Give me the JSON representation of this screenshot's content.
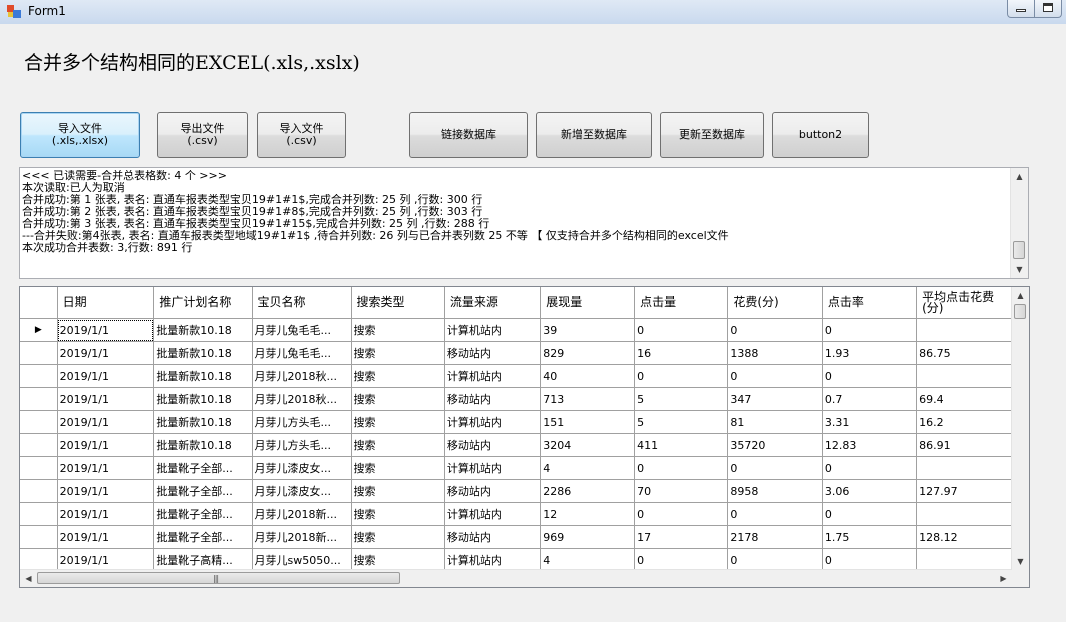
{
  "window": {
    "title": "Form1"
  },
  "heading": "合并多个结构相同的EXCEL(.xls,.xslx)",
  "buttons": {
    "import_xls": {
      "line1": "导入文件",
      "line2": "(.xls,.xlsx)"
    },
    "export_csv": {
      "line1": "导出文件",
      "line2": "(.csv)"
    },
    "import_csv": {
      "line1": "导入文件",
      "line2": "(.csv)"
    },
    "link_db": "链接数据库",
    "add_db": "新增至数据库",
    "update_db": "更新至数据库",
    "button2": "button2"
  },
  "log_lines": [
    "<<< 已读需要-合并总表格数: 4 个 >>>",
    "本次读取:已人为取消",
    "合并成功:第 1 张表, 表名: 直通车报表类型宝贝19#1#1$,完成合并列数: 25 列 ,行数: 300 行",
    "合并成功:第 2 张表, 表名: 直通车报表类型宝贝19#1#8$,完成合并列数: 25 列 ,行数: 303 行",
    "合并成功:第 3 张表, 表名: 直通车报表类型宝贝19#1#15$,完成合并列数: 25 列 ,行数: 288 行",
    "---合并失败:第4张表, 表名: 直通车报表类型地域19#1#1$ ,待合并列数: 26 列与已合并表列数 25 不等 【 仅支持合并多个结构相同的excel文件",
    "本次成功合并表数: 3,行数: 891 行"
  ],
  "grid": {
    "columns": [
      "日期",
      "推广计划名称",
      "宝贝名称",
      "搜索类型",
      "流量来源",
      "展现量",
      "点击量",
      "花费(分)",
      "点击率",
      "平均点击花费(分)"
    ],
    "rows": [
      [
        "2019/1/1",
        "批量新款10.18",
        "月芽儿兔毛毛...",
        "搜索",
        "计算机站内",
        "39",
        "0",
        "0",
        "0",
        ""
      ],
      [
        "2019/1/1",
        "批量新款10.18",
        "月芽儿兔毛毛...",
        "搜索",
        "移动站内",
        "829",
        "16",
        "1388",
        "1.93",
        "86.75"
      ],
      [
        "2019/1/1",
        "批量新款10.18",
        "月芽儿2018秋...",
        "搜索",
        "计算机站内",
        "40",
        "0",
        "0",
        "0",
        ""
      ],
      [
        "2019/1/1",
        "批量新款10.18",
        "月芽儿2018秋...",
        "搜索",
        "移动站内",
        "713",
        "5",
        "347",
        "0.7",
        "69.4"
      ],
      [
        "2019/1/1",
        "批量新款10.18",
        "月芽儿方头毛...",
        "搜索",
        "计算机站内",
        "151",
        "5",
        "81",
        "3.31",
        "16.2"
      ],
      [
        "2019/1/1",
        "批量新款10.18",
        "月芽儿方头毛...",
        "搜索",
        "移动站内",
        "3204",
        "411",
        "35720",
        "12.83",
        "86.91"
      ],
      [
        "2019/1/1",
        "批量靴子全部...",
        "月芽儿漆皮女...",
        "搜索",
        "计算机站内",
        "4",
        "0",
        "0",
        "0",
        ""
      ],
      [
        "2019/1/1",
        "批量靴子全部...",
        "月芽儿漆皮女...",
        "搜索",
        "移动站内",
        "2286",
        "70",
        "8958",
        "3.06",
        "127.97"
      ],
      [
        "2019/1/1",
        "批量靴子全部...",
        "月芽儿2018新...",
        "搜索",
        "计算机站内",
        "12",
        "0",
        "0",
        "0",
        ""
      ],
      [
        "2019/1/1",
        "批量靴子全部...",
        "月芽儿2018新...",
        "搜索",
        "移动站内",
        "969",
        "17",
        "2178",
        "1.75",
        "128.12"
      ],
      [
        "2019/1/1",
        "批量靴子高精...",
        "月芽儿sw5050...",
        "搜索",
        "计算机站内",
        "4",
        "0",
        "0",
        "0",
        ""
      ]
    ],
    "current_row_marker": "▶"
  },
  "icons": {
    "scroll_up": "▲",
    "scroll_down": "▼",
    "scroll_left": "◀",
    "scroll_right": "▶",
    "grip": "|||"
  }
}
